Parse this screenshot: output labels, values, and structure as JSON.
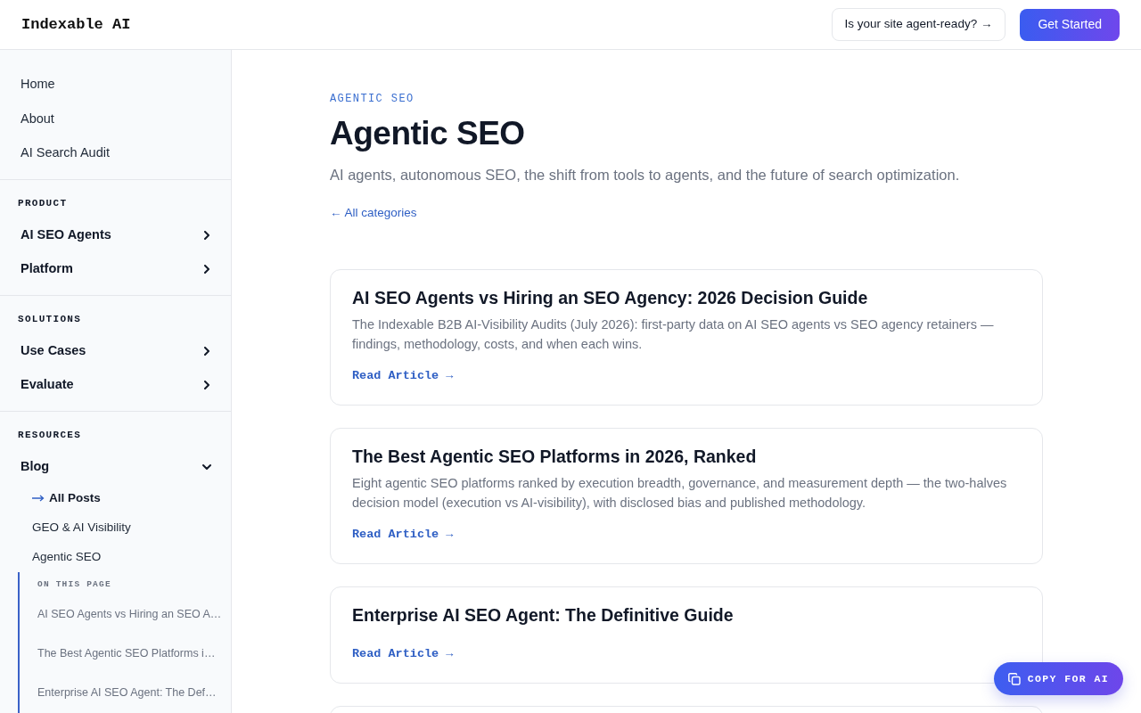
{
  "header": {
    "logo": "Indexable AI",
    "buttons": [
      {
        "label": "Is your site agent-ready? →",
        "kind": "outline"
      },
      {
        "label": "Get Started",
        "kind": "primary"
      }
    ]
  },
  "sidebar": {
    "top_links": [
      {
        "label": "Home"
      },
      {
        "label": "About"
      },
      {
        "label": "AI Search Audit"
      }
    ],
    "sections": [
      {
        "title": "PRODUCT",
        "items": [
          {
            "label": "AI SEO Agents",
            "expanded": false
          },
          {
            "label": "Platform",
            "expanded": false
          }
        ]
      },
      {
        "title": "SOLUTIONS",
        "items": [
          {
            "label": "Use Cases",
            "expanded": false
          },
          {
            "label": "Evaluate",
            "expanded": false
          }
        ]
      },
      {
        "title": "RESOURCES",
        "items": [
          {
            "label": "Blog",
            "expanded": true,
            "children": [
              {
                "label": "All Posts",
                "selected": true
              },
              {
                "label": "GEO & AI Visibility",
                "selected": false
              },
              {
                "label": "Agentic SEO",
                "selected": false
              }
            ],
            "on_this_page": {
              "title": "ON THIS PAGE",
              "items": [
                {
                  "label": "AI SEO Agents vs Hiring an SEO A…"
                },
                {
                  "label": "The Best Agentic SEO Platforms i…"
                },
                {
                  "label": "Enterprise AI SEO Agent: The Def…"
                }
              ]
            }
          }
        ]
      }
    ]
  },
  "category": {
    "eyebrow": "AGENTIC SEO",
    "title": "Agentic SEO",
    "description": "AI agents, autonomous SEO, the shift from tools to agents, and the future of search optimization.",
    "back_link": "← All categories"
  },
  "articles": [
    {
      "title": "AI SEO Agents vs Hiring an SEO Agency: 2026 Decision Guide",
      "summary": "The Indexable B2B AI-Visibility Audits (July 2026): first-party data on AI SEO agents vs SEO agency retainers — findings, methodology, costs, and when each wins.",
      "link": "Read Article →"
    },
    {
      "title": "The Best Agentic SEO Platforms in 2026, Ranked",
      "summary": "Eight agentic SEO platforms ranked by execution breadth, governance, and measurement depth — the two-halves decision model (execution vs AI-visibility), with disclosed bias and published methodology.",
      "link": "Read Article →"
    },
    {
      "title": "Enterprise AI SEO Agent: The Definitive Guide",
      "link": "Read Article →"
    }
  ],
  "copy_button": {
    "label": "COPY FOR AI"
  }
}
